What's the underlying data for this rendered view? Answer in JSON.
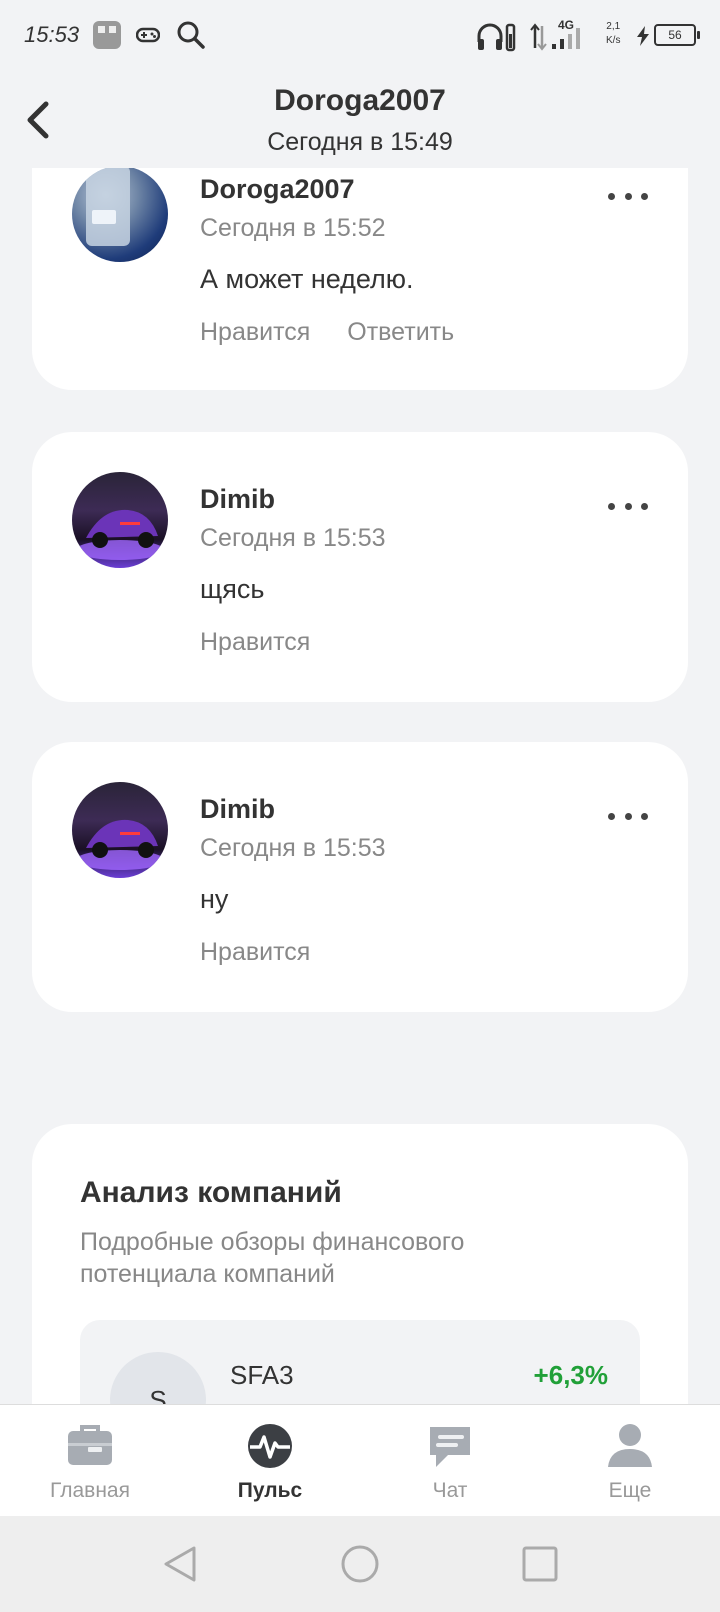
{
  "status": {
    "time": "15:53",
    "network": "4G",
    "speed_value": "2,1",
    "speed_unit": "K/s",
    "battery": "56"
  },
  "header": {
    "title": "Doroga2007",
    "subtitle": "Сегодня в 15:49"
  },
  "comments": [
    {
      "author": "Doroga2007",
      "time": "Сегодня в 15:52",
      "text": "А может неделю.",
      "like": "Нравится",
      "reply": "Ответить"
    },
    {
      "author": "Dimib",
      "time": "Сегодня в 15:53",
      "text": "щясь",
      "like": "Нравится"
    },
    {
      "author": "Dimib",
      "time": "Сегодня в 15:53",
      "text": "ну",
      "like": "Нравится"
    }
  ],
  "analysis": {
    "title": "Анализ компаний",
    "description": "Подробные обзоры финансового потенциала компаний",
    "item": {
      "logo": "S",
      "ticker": "SFA3",
      "change": "+6,3%"
    }
  },
  "tabs": [
    {
      "label": "Главная",
      "icon": "briefcase-icon"
    },
    {
      "label": "Пульс",
      "icon": "pulse-icon"
    },
    {
      "label": "Чат",
      "icon": "chat-icon"
    },
    {
      "label": "Еще",
      "icon": "profile-icon"
    }
  ],
  "colors": {
    "background": "#f2f3f5",
    "positive": "#21a038",
    "muted_text": "#888888"
  }
}
